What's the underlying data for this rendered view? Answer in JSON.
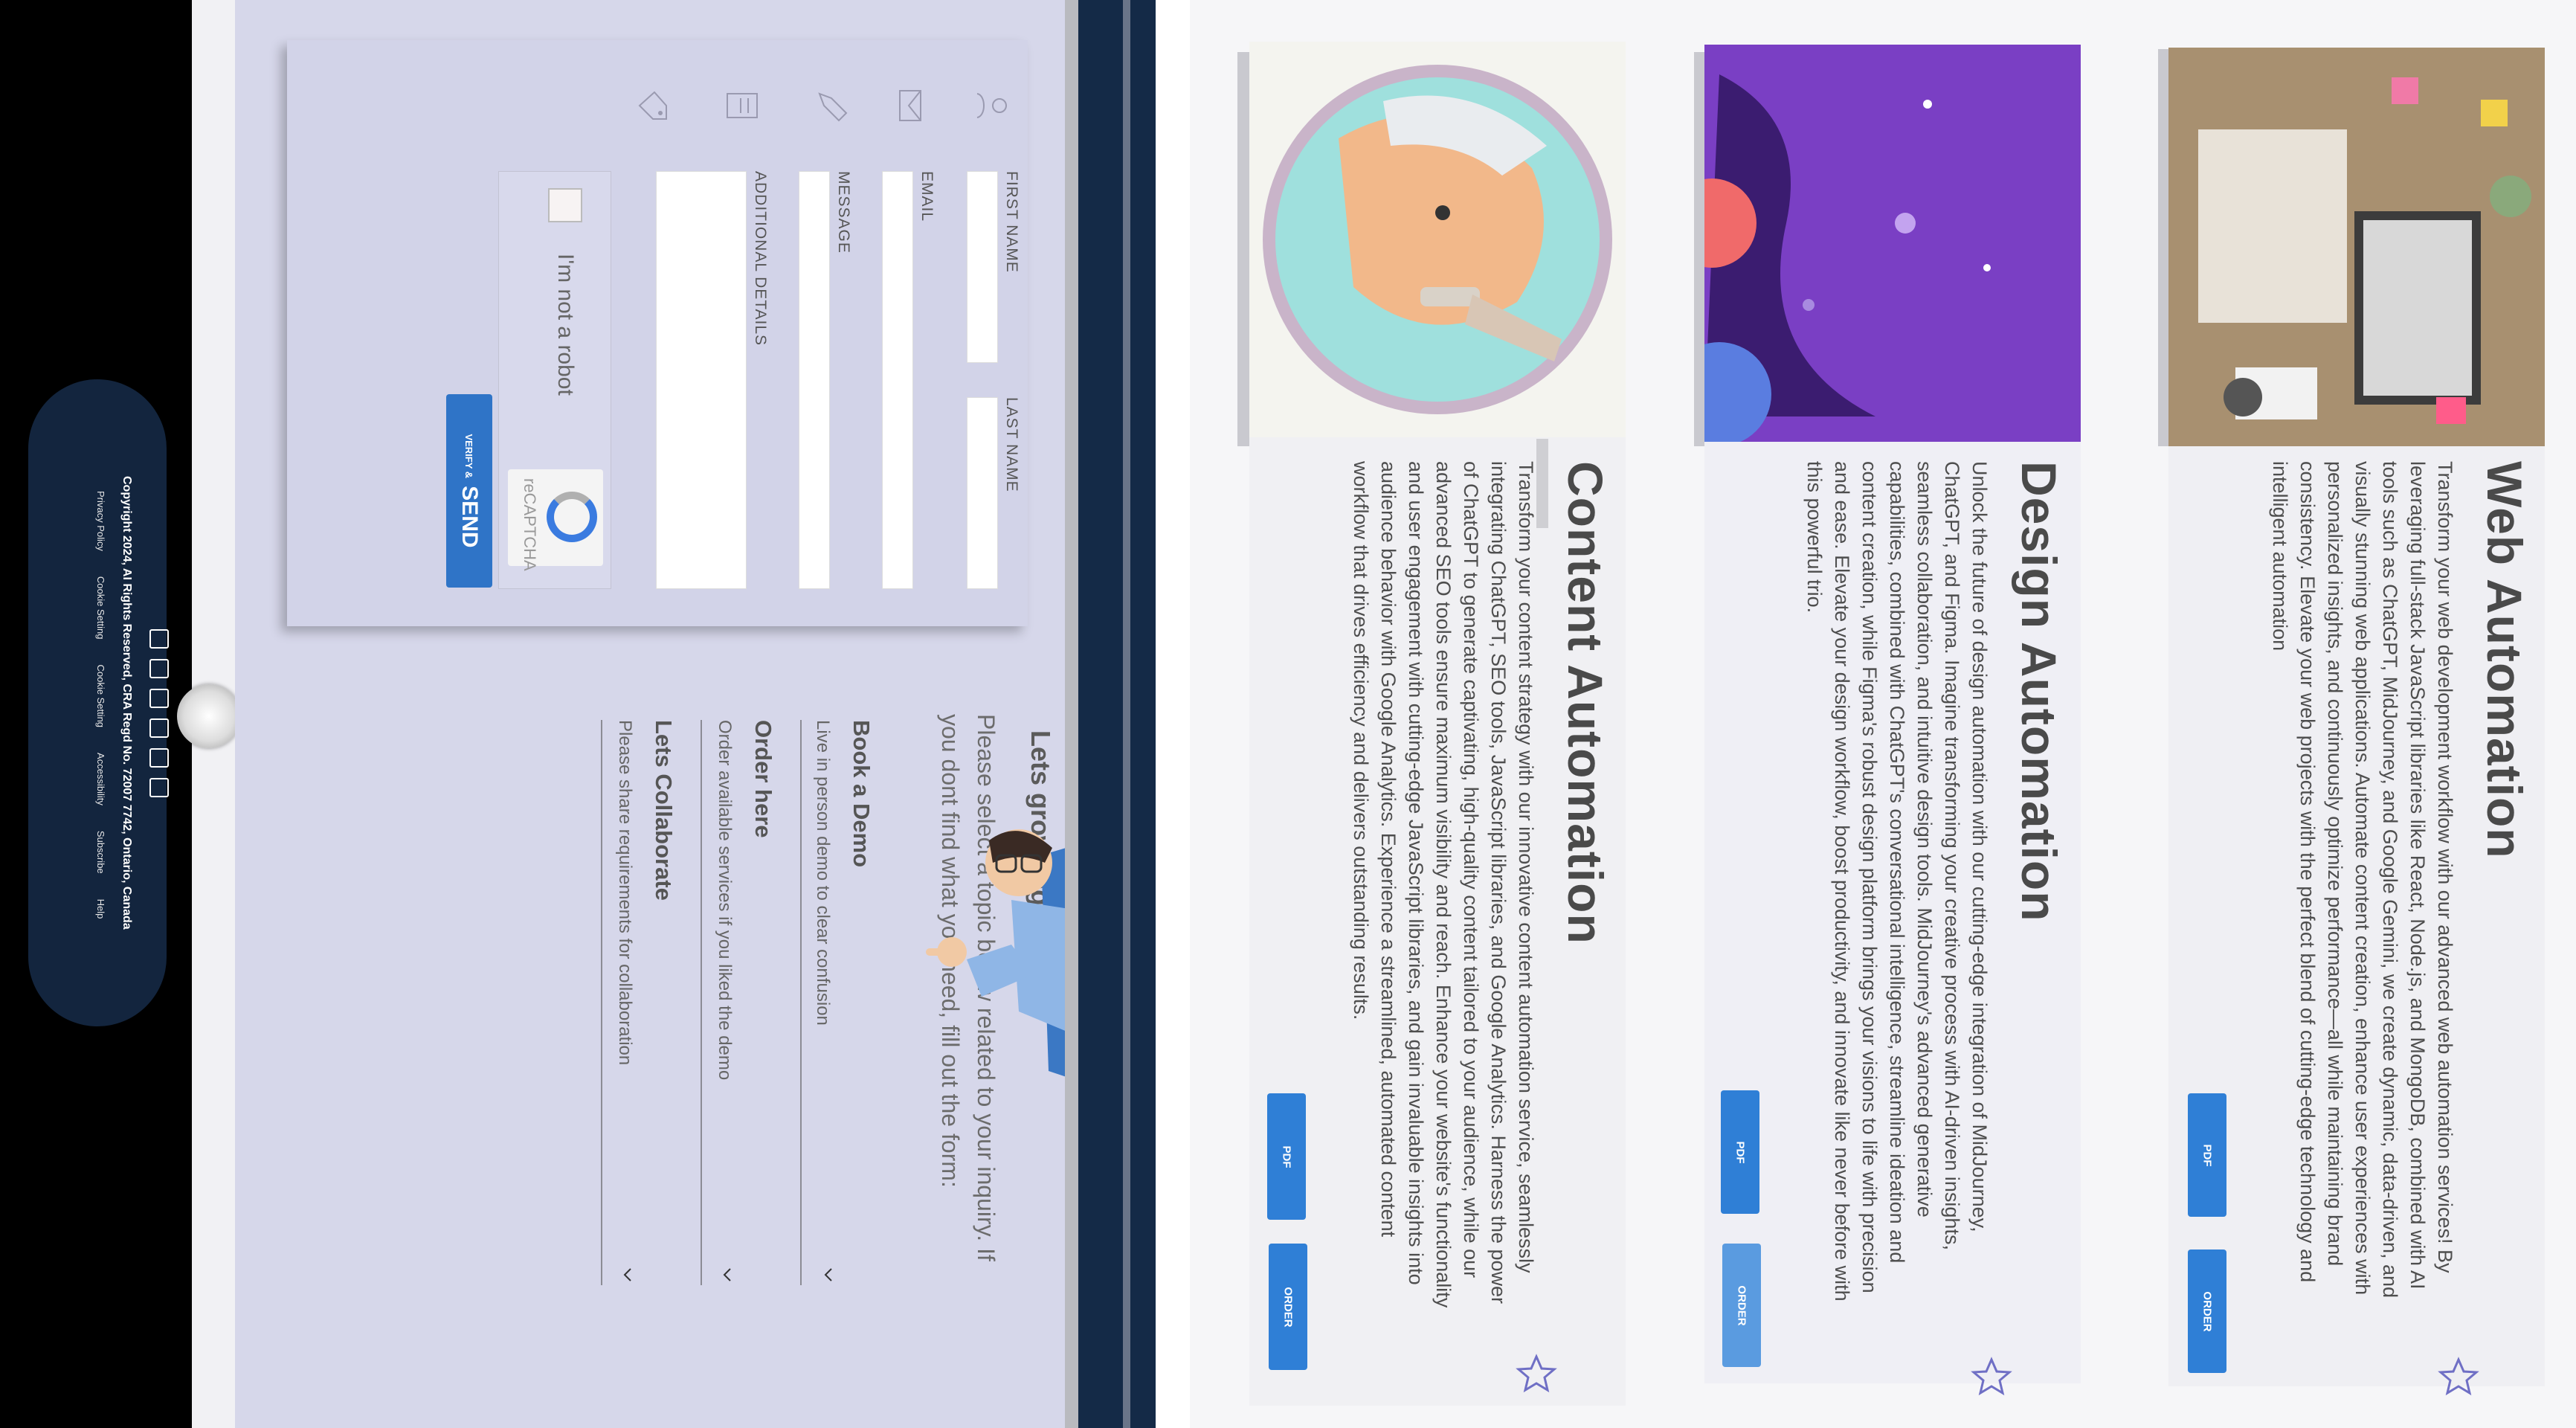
{
  "services": [
    {
      "title": "Web Automation",
      "description": "Transform your web development workflow with our advanced web automation services! By leveraging full-stack JavaScript libraries like React, Node.js, and MongoDB, combined with AI tools such as ChatGPT, MidJourney, and Google Gemini, we create dynamic, data-driven, and visually stunning web applications. Automate content creation, enhance user experiences with personalized insights, and continuously optimize performance—all while maintaining brand consistency. Elevate your web projects with the perfect blend of cutting-edge technology and intelligent automation",
      "pdf_label": "PDF",
      "order_label": "ORDER"
    },
    {
      "title": "Design Automation",
      "description": "Unlock the future of design automation with our cutting-edge integration of MidJourney, ChatGPT, and Figma. Imagine transforming your creative process with AI-driven insights, seamless collaboration, and intuitive design tools. MidJourney's advanced generative capabilities, combined with ChatGPT's conversational intelligence, streamline ideation and content creation, while Figma's robust design platform brings your visions to life with precision and ease. Elevate your design workflow, boost productivity, and innovate like never before with this powerful trio.",
      "pdf_label": "PDF",
      "order_label": "ORDER"
    },
    {
      "title": "Content Automation",
      "description": "Transform your content strategy with our innovative content automation service, seamlessly integrating ChatGPT, SEO tools, JavaScript libraries, and Google Analytics. Harness the power of ChatGPT to generate captivating, high-quality content tailored to your audience, while our advanced SEO tools ensure maximum visibility and reach. Enhance your website's functionality and user engagement with cutting-edge JavaScript libraries, and gain invaluable insights into audience behavior with Google Analytics. Experience a streamlined, automated content workflow that drives efficiency and delivers outstanding results.",
      "pdf_label": "PDF",
      "order_label": "ORDER"
    }
  ],
  "contact": {
    "title": "Lets grow together",
    "intro": "Please select a topic below related to your inquiry. If you dont find what you need, fill out the form:",
    "topics": [
      {
        "title": "Book a Demo",
        "subtitle": "Live in person demo to clear confusion"
      },
      {
        "title": "Order here",
        "subtitle": "Order available services if you liked the demo"
      },
      {
        "title": "Lets Collaborate",
        "subtitle": "Please share requirements for collaboration"
      }
    ]
  },
  "form": {
    "first_name_label": "FIRST NAME",
    "last_name_label": "LAST NAME",
    "email_label": "EMAIL",
    "message_label": "MESSAGE",
    "details_label": "ADDITIONAL DETAILS",
    "captcha_text": "I'm not a robot",
    "captcha_brand": "reCAPTCHA",
    "send_small": "VERIFY &",
    "send_label": "SEND"
  },
  "footer": {
    "copyright": "Copyright 2024, AI Rights Reserved, CRA Regd No. 72007 7742, Ontario, Canada",
    "links": [
      "Privacy Policy",
      "Cookie Setting",
      "Cookie Setting",
      "Accessibility",
      "Subscribe",
      "Help"
    ],
    "social_icons": [
      "facebook-icon",
      "twitter-icon",
      "mail-icon",
      "instagram-icon",
      "linkedin-icon",
      "youtube-icon"
    ]
  },
  "colors": {
    "accent_blue": "#2f7fd6",
    "navy": "#142a47",
    "lavender": "#d6d7ea",
    "star": "#6f6fc5"
  }
}
